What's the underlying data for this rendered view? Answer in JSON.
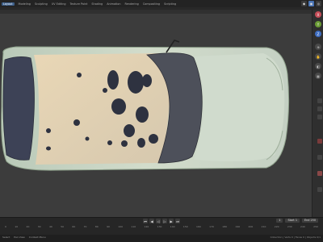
{
  "app": {
    "menus": [
      "Layout",
      "Modeling",
      "Sculpting",
      "UV Editing",
      "Texture Paint",
      "Shading",
      "Animation",
      "Rendering",
      "Compositing",
      "Scripting"
    ],
    "active_menu": "Layout"
  },
  "colors": {
    "accent": "#4772b3",
    "viewport_bg": "#3c3c3c",
    "car_body": "#cfdcc8",
    "roof": "#e3cfb0"
  },
  "icons": {
    "toolbar_right": [
      "scene-icon",
      "view-layer-icon",
      "render-icon"
    ],
    "gizmo": [
      "axis-x-icon",
      "axis-y-icon",
      "axis-z-icon",
      "zoom-icon",
      "pan-icon",
      "camera-icon",
      "perspective-icon"
    ]
  },
  "timeline": {
    "current_frame": "1",
    "start_label": "Start",
    "start": "1",
    "end_label": "End",
    "end": "250",
    "ruler": [
      "0",
      "10",
      "20",
      "30",
      "40",
      "50",
      "60",
      "70",
      "80",
      "90",
      "100",
      "110",
      "120",
      "130",
      "140",
      "150",
      "160",
      "170",
      "180",
      "190",
      "200",
      "210",
      "220",
      "230",
      "240",
      "250"
    ]
  },
  "status": {
    "left": [
      "Select",
      "Pan View",
      "Context Menu"
    ],
    "right": "Collection | Verts 0 | Faces 0 | Objects 0/1"
  }
}
